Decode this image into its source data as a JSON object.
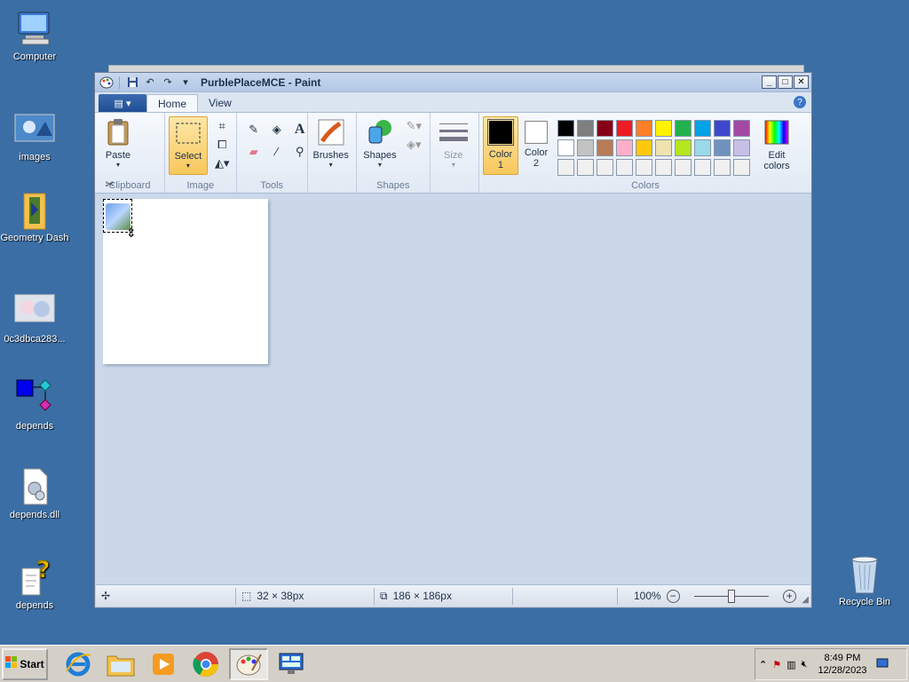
{
  "desktop": {
    "icons": [
      {
        "label": "Computer",
        "icon": "computer-icon"
      },
      {
        "label": "images",
        "icon": "image-file-icon"
      },
      {
        "label": "Geometry Dash",
        "icon": "folder-icon"
      },
      {
        "label": "0c3dbca283...",
        "icon": "image-file-icon"
      },
      {
        "label": "depends",
        "icon": "depends-app-icon"
      },
      {
        "label": "depends.dll",
        "icon": "dll-file-icon"
      },
      {
        "label": "depends",
        "icon": "help-file-icon"
      }
    ],
    "recycle_bin": {
      "label": "Recycle Bin",
      "icon": "recycle-bin-icon"
    }
  },
  "window": {
    "title": "PurblePlaceMCE - Paint",
    "controls": {
      "minimize": "_",
      "maximize": "□",
      "close": "✕"
    },
    "tabs": [
      {
        "label": "Home",
        "active": true
      },
      {
        "label": "View",
        "active": false
      }
    ],
    "ribbon": {
      "clipboard": {
        "group": "Clipboard",
        "paste": "Paste"
      },
      "image": {
        "group": "Image",
        "select": "Select"
      },
      "tools": {
        "group": "Tools"
      },
      "brushes": {
        "label": "Brushes"
      },
      "shapes": {
        "group": "Shapes",
        "label": "Shapes"
      },
      "size": {
        "label": "Size"
      },
      "colors": {
        "group": "Colors",
        "color1_label": "Color",
        "color1_num": "1",
        "color2_label": "Color",
        "color2_num": "2",
        "edit_label": "Edit",
        "edit_label2": "colors",
        "color1": "#000000",
        "color2": "#ffffff",
        "palette": [
          "#000000",
          "#7f7f7f",
          "#880015",
          "#ed1c24",
          "#ff7f27",
          "#fff200",
          "#22b14c",
          "#00a2e8",
          "#3f48cc",
          "#a349a4",
          "#ffffff",
          "#c3c3c3",
          "#b97a57",
          "#ffaec9",
          "#ffc90e",
          "#efe4b0",
          "#b5e61d",
          "#99d9ea",
          "#7092be",
          "#c8bfe7",
          "#f0f0f0",
          "#f0f0f0",
          "#f0f0f0",
          "#f0f0f0",
          "#f0f0f0",
          "#f0f0f0",
          "#f0f0f0",
          "#f0f0f0",
          "#f0f0f0",
          "#f0f0f0"
        ]
      }
    },
    "status": {
      "selection_size": "32 × 38px",
      "canvas_size": "186 × 186px",
      "zoom": "100%"
    }
  },
  "taskbar": {
    "start": "Start",
    "apps": [
      "internet-explorer-icon",
      "explorer-folder-icon",
      "media-player-icon",
      "chrome-icon",
      "paint-icon",
      "remote-desktop-icon"
    ],
    "clock_time": "8:49 PM",
    "clock_date": "12/28/2023",
    "tray_expand": "⌃"
  }
}
